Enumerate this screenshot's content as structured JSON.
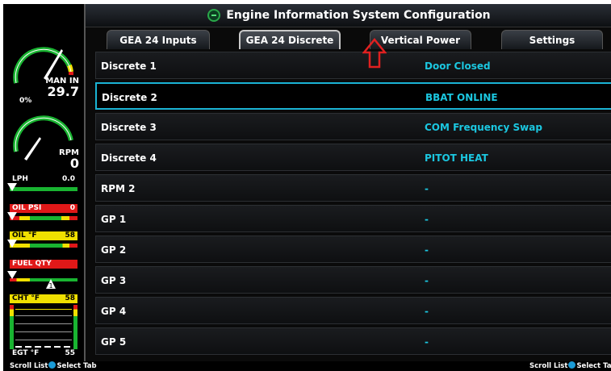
{
  "title": "Engine Information System Configuration",
  "tabs": [
    {
      "label": "GEA 24 Inputs",
      "active": false
    },
    {
      "label": "GEA 24 Discrete",
      "active": true
    },
    {
      "label": "Vertical Power",
      "active": false
    },
    {
      "label": "Settings",
      "active": false
    }
  ],
  "rows": [
    {
      "name": "Discrete 1",
      "value": "Door Closed",
      "selected": false
    },
    {
      "name": "Discrete 2",
      "value": "BBAT ONLINE",
      "selected": true
    },
    {
      "name": "Discrete 3",
      "value": "COM Frequency Swap",
      "selected": false
    },
    {
      "name": "Discrete 4",
      "value": "PITOT HEAT",
      "selected": false
    },
    {
      "name": "RPM 2",
      "value": "-",
      "selected": false
    },
    {
      "name": "GP 1",
      "value": "-",
      "selected": false
    },
    {
      "name": "GP 2",
      "value": "-",
      "selected": false
    },
    {
      "name": "GP 3",
      "value": "-",
      "selected": false
    },
    {
      "name": "GP 4",
      "value": "-",
      "selected": false
    },
    {
      "name": "GP 5",
      "value": "-",
      "selected": false
    }
  ],
  "engine": {
    "man_in": {
      "label": "MAN IN",
      "value": "29.7",
      "min_label": "0%"
    },
    "rpm": {
      "label": "RPM",
      "value": "0"
    },
    "lph": {
      "label": "LPH",
      "value": "0.0"
    },
    "oil_psi": {
      "label": "OIL PSI",
      "value": "0"
    },
    "oil_f": {
      "label": "OIL °F",
      "value": "58"
    },
    "fuel_qty": {
      "label": "FUEL QTY"
    },
    "cht": {
      "label": "CHT °F",
      "value": "58"
    },
    "egt": {
      "label": "EGT °F",
      "value": "55"
    }
  },
  "footer": {
    "left_scroll": "Scroll List",
    "left_select": "Select Tab",
    "right_scroll": "Scroll List",
    "right_select": "Select Ta"
  },
  "colors": {
    "accent_cyan": "#1bc7e0",
    "selection_border": "#1ab3d4",
    "gauge_green": "#19b431",
    "caution_yellow": "#f0e000",
    "warning_red": "#e01818",
    "annotation_arrow": "#e02020"
  }
}
